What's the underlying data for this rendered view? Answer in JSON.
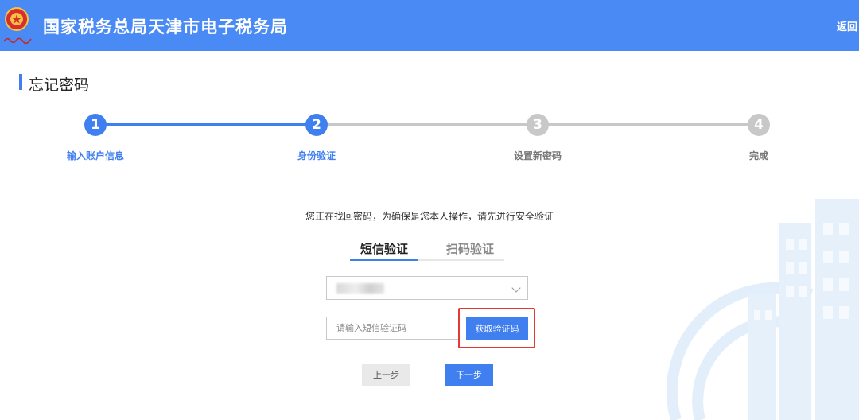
{
  "header": {
    "title": "国家税务总局天津市电子税务局",
    "back_label": "返回",
    "emblem_icon": "tax-emblem-icon",
    "background_color": "#4a8af4"
  },
  "page": {
    "title": "忘记密码"
  },
  "stepper": {
    "active_color": "#3f7ff0",
    "inactive_color": "#c8c8c8",
    "steps": [
      {
        "number": "1",
        "label": "输入账户信息",
        "status": "done"
      },
      {
        "number": "2",
        "label": "身份验证",
        "status": "current"
      },
      {
        "number": "3",
        "label": "设置新密码",
        "status": "pending"
      },
      {
        "number": "4",
        "label": "完成",
        "status": "pending"
      }
    ]
  },
  "verify": {
    "instruction": "您正在找回密码，为确保是您本人操作，请先进行安全验证",
    "tabs": [
      {
        "label": "短信验证",
        "active": true
      },
      {
        "label": "扫码验证",
        "active": false
      }
    ],
    "phone_select": {
      "value": "",
      "icon": "chevron-down-icon"
    },
    "code_input": {
      "value": "",
      "placeholder": "请输入短信验证码"
    },
    "get_code_label": "获取验证码"
  },
  "nav": {
    "prev_label": "上一步",
    "next_label": "下一步"
  }
}
